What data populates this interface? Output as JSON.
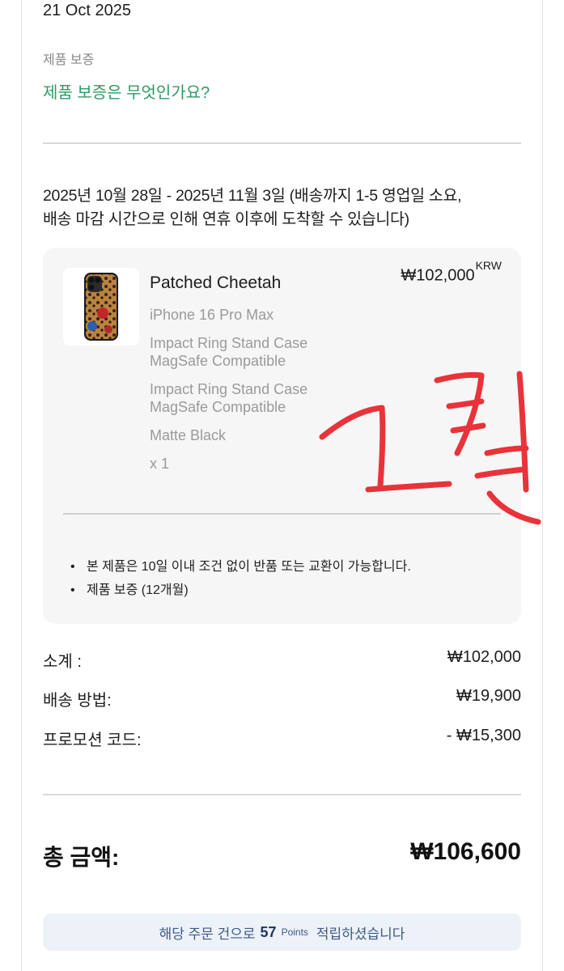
{
  "order": {
    "date": "21 Oct 2025"
  },
  "warranty": {
    "label": "제품 보증",
    "link": "제품 보증은 무엇인가요?"
  },
  "delivery": {
    "line1": "2025년 10월 28일 - 2025년 11월 3일 (배송까지 1-5 영업일 소요,",
    "line2": "배송 마감 시간으로 인해 연휴 이후에 도착할 수 있습니다)"
  },
  "product": {
    "name": "Patched Cheetah",
    "price": "₩102,000",
    "currency": "KRW",
    "attributes": [
      "iPhone 16 Pro Max",
      "Impact Ring Stand Case",
      "MagSafe Compatible",
      "Impact Ring Stand Case",
      "MagSafe Compatible",
      "Matte Black",
      "x 1"
    ],
    "notes": [
      "본 제품은 10일 이내 조건 없이 반품 또는 교환이 가능합니다.",
      "제품 보증 (12개월)"
    ],
    "thumbnail_icon": "phone-case-icon"
  },
  "summary": {
    "subtotal": {
      "label": "소계 :",
      "value": "₩102,000"
    },
    "shipping": {
      "label": "배송 방법:",
      "value": "₩19,900"
    },
    "promo": {
      "label": "프로모션 코드:",
      "value": "- ₩15,300"
    },
    "total": {
      "label": "총 금액:",
      "value": "₩106,600"
    }
  },
  "points": {
    "prefix": "해당 주문 건으로",
    "amount": "57",
    "unit": "Points",
    "suffix": "적립하셨습니다"
  },
  "colors": {
    "link_green": "#2e9a63",
    "banner_bg": "#edf1f8",
    "handwriting_red": "#e8333a"
  }
}
